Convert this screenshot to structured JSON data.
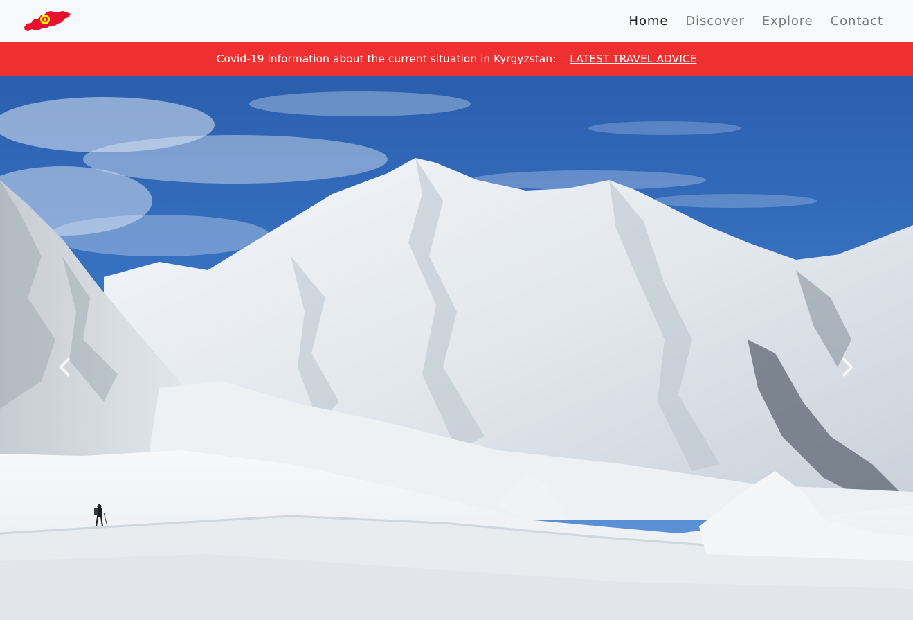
{
  "brand": {
    "logo_icon": "kyrgyzstan-map-flag-icon",
    "colors": {
      "flag_red": "#e8112d",
      "sun_yellow": "#ffef00"
    }
  },
  "nav": {
    "items": [
      {
        "label": "Home",
        "active": true
      },
      {
        "label": "Discover",
        "active": false
      },
      {
        "label": "Explore",
        "active": false
      },
      {
        "label": "Contact",
        "active": false
      }
    ]
  },
  "alert": {
    "text": "Covid-19 information about the current situation in Kyrgyzstan:",
    "link_label": "LATEST TRAVEL ADVICE",
    "background": "#f03030"
  },
  "hero": {
    "image": "snow-covered-mountain-peak-with-climber",
    "prev_icon": "chevron-left-icon",
    "next_icon": "chevron-right-icon"
  }
}
